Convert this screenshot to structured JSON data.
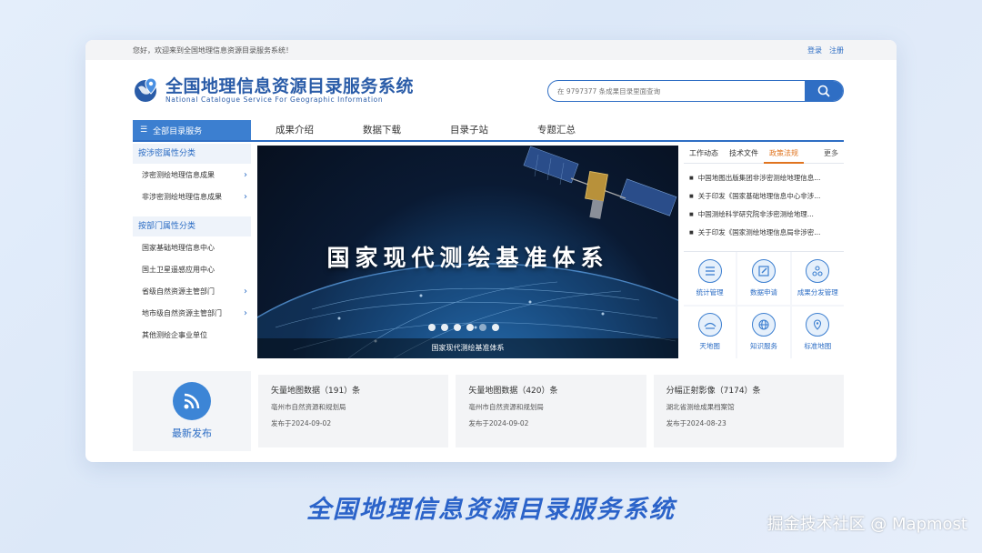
{
  "topbar": {
    "welcome": "您好，欢迎来到全国地理信息资源目录服务系统！",
    "login": "登录",
    "register": "注册"
  },
  "logo": {
    "title": "全国地理信息资源目录服务系统",
    "subtitle": "National Catalogue Service For Geographic Information"
  },
  "search": {
    "placeholder": "在 9797377 条成果目录里面查询"
  },
  "nav": {
    "all": "全部目录服务",
    "items": [
      "成果介绍",
      "数据下载",
      "目录子站",
      "专题汇总"
    ]
  },
  "sidebar": {
    "cat1": "按涉密属性分类",
    "cat1_items": [
      "涉密测绘地理信息成果",
      "非涉密测绘地理信息成果"
    ],
    "cat2": "按部门属性分类",
    "cat2_items": [
      "国家基础地理信息中心",
      "国土卫星遥感应用中心",
      "省级自然资源主管部门",
      "地市级自然资源主管部门",
      "其他测绘企事业单位"
    ]
  },
  "banner": {
    "title": "国家现代测绘基准体系",
    "caption": "国家现代测绘基准体系"
  },
  "right": {
    "tabs": [
      "工作动态",
      "技术文件",
      "政策法规"
    ],
    "more": "更多",
    "news": [
      "中国地图出版集团非涉密测绘地理信息...",
      "关于印发《国家基础地理信息中心非涉...",
      "中国测绘科学研究院非涉密测绘地理...",
      "关于印发《国家测绘地理信息局非涉密..."
    ],
    "services": [
      "统计管理",
      "数据申请",
      "成果分发管理",
      "天地图",
      "知识服务",
      "标准地图"
    ]
  },
  "latest": {
    "label": "最新发布"
  },
  "cards": [
    {
      "title": "矢量地图数据（191）条",
      "org": "亳州市自然资源和规划局",
      "date": "发布于2024-09-02"
    },
    {
      "title": "矢量地图数据（420）条",
      "org": "亳州市自然资源和规划局",
      "date": "发布于2024-09-02"
    },
    {
      "title": "分幅正射影像（7174）条",
      "org": "湖北省测绘成果档案馆",
      "date": "发布于2024-08-23"
    }
  ],
  "caption": "全国地理信息资源目录服务系统",
  "watermark": "掘金技术社区 @ Mapmost"
}
